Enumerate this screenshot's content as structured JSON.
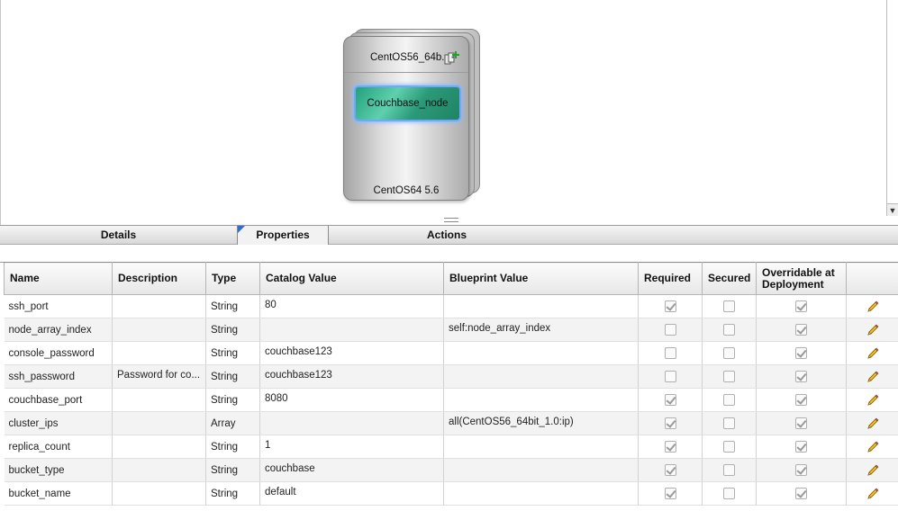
{
  "canvas": {
    "vm": {
      "title": "CentOS56_64b...",
      "node_label": "Couchbase_node",
      "os_label": "CentOS64 5.6",
      "add_icon": "add-component-icon"
    },
    "scroll_down_icon": "chevron-down-icon"
  },
  "tabs": [
    {
      "label": "Details"
    },
    {
      "label": "Properties"
    },
    {
      "label": "Actions"
    }
  ],
  "table": {
    "columns": {
      "name": "Name",
      "description": "Description",
      "type": "Type",
      "catalog_value": "Catalog Value",
      "blueprint_value": "Blueprint Value",
      "required": "Required",
      "secured": "Secured",
      "overridable": "Overridable at Deployment"
    },
    "rows": [
      {
        "name": "ssh_port",
        "description": "",
        "type": "String",
        "catalog_value": "80",
        "blueprint_value": "",
        "required": true,
        "secured": false,
        "overridable": true
      },
      {
        "name": "node_array_index",
        "description": "",
        "type": "String",
        "catalog_value": "",
        "blueprint_value": "self:node_array_index",
        "required": false,
        "secured": false,
        "overridable": true
      },
      {
        "name": "console_password",
        "description": "",
        "type": "String",
        "catalog_value": "couchbase123",
        "blueprint_value": "",
        "required": false,
        "secured": false,
        "overridable": true
      },
      {
        "name": "ssh_password",
        "description": "Password for co...",
        "type": "String",
        "catalog_value": "couchbase123",
        "blueprint_value": "",
        "required": false,
        "secured": false,
        "overridable": true
      },
      {
        "name": "couchbase_port",
        "description": "",
        "type": "String",
        "catalog_value": "8080",
        "blueprint_value": "",
        "required": true,
        "secured": false,
        "overridable": true
      },
      {
        "name": "cluster_ips",
        "description": "",
        "type": "Array",
        "catalog_value": "",
        "blueprint_value": "all(CentOS56_64bit_1.0:ip)",
        "required": true,
        "secured": false,
        "overridable": true
      },
      {
        "name": "replica_count",
        "description": "",
        "type": "String",
        "catalog_value": "1",
        "blueprint_value": "",
        "required": true,
        "secured": false,
        "overridable": true
      },
      {
        "name": "bucket_type",
        "description": "",
        "type": "String",
        "catalog_value": "couchbase",
        "blueprint_value": "",
        "required": true,
        "secured": false,
        "overridable": true
      },
      {
        "name": "bucket_name",
        "description": "",
        "type": "String",
        "catalog_value": "default",
        "blueprint_value": "",
        "required": true,
        "secured": false,
        "overridable": true
      }
    ],
    "edit_icon": "pencil-icon"
  }
}
